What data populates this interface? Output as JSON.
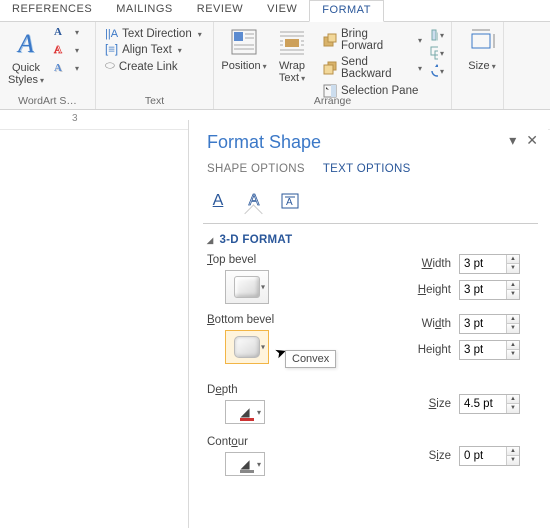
{
  "ribbon": {
    "tabs": [
      "REFERENCES",
      "MAILINGS",
      "REVIEW",
      "VIEW",
      "FORMAT"
    ],
    "active_tab": "FORMAT",
    "groups": {
      "wordart": {
        "label": "WordArt S…",
        "quick_styles": "Quick Styles"
      },
      "text": {
        "label": "Text",
        "text_direction": "Text Direction",
        "align_text": "Align Text",
        "create_link": "Create Link"
      },
      "arrange": {
        "label": "Arrange",
        "position": "Position",
        "wrap_text": "Wrap Text",
        "bring_forward": "Bring Forward",
        "send_backward": "Send Backward",
        "selection_pane": "Selection Pane"
      },
      "size": {
        "label": "Size"
      }
    }
  },
  "ruler": {
    "mark": "3"
  },
  "pane": {
    "title": "Format Shape",
    "tabs": {
      "shape": "SHAPE OPTIONS",
      "text": "TEXT OPTIONS",
      "active": "text"
    },
    "section": "3-D FORMAT",
    "top_bevel": {
      "label": "Top bevel",
      "width_label": "Width",
      "width": "3 pt",
      "height_label": "Height",
      "height": "3 pt"
    },
    "bottom_bevel": {
      "label": "Bottom bevel",
      "width_label": "Width",
      "width": "3 pt",
      "height_label": "Height",
      "height": "3 pt",
      "tooltip": "Convex"
    },
    "depth": {
      "label": "Depth",
      "size_label": "Size",
      "size": "4.5 pt"
    },
    "contour": {
      "label": "Contour",
      "size_label": "Size",
      "size": "0 pt"
    }
  }
}
